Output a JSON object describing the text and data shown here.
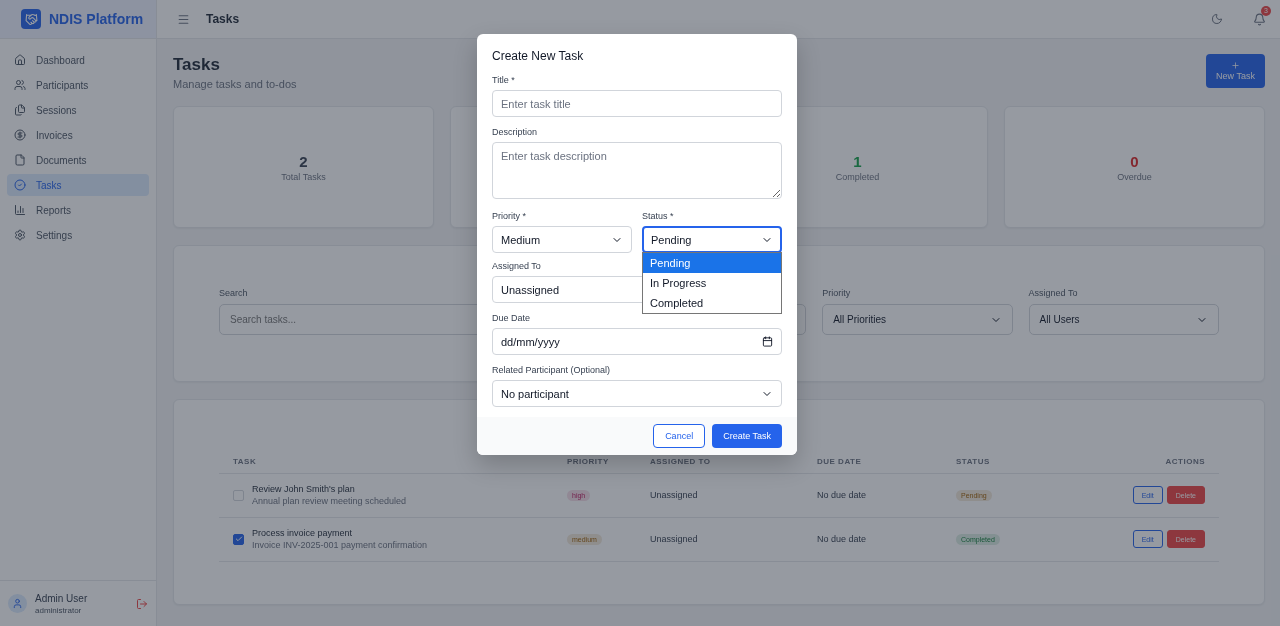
{
  "app": {
    "name": "NDIS Platform"
  },
  "sidebar": {
    "items": [
      {
        "label": "Dashboard",
        "selected": false
      },
      {
        "label": "Participants",
        "selected": false
      },
      {
        "label": "Sessions",
        "selected": false
      },
      {
        "label": "Invoices",
        "selected": false
      },
      {
        "label": "Documents",
        "selected": false
      },
      {
        "label": "Tasks",
        "selected": true
      },
      {
        "label": "Reports",
        "selected": false
      },
      {
        "label": "Settings",
        "selected": false
      }
    ],
    "user": {
      "name": "Admin User",
      "role": "administrator"
    }
  },
  "header": {
    "title": "Tasks",
    "notification_count": "3"
  },
  "page": {
    "title": "Tasks",
    "subtitle": "Manage tasks and to-dos",
    "new_button": "New Task"
  },
  "stats": [
    {
      "value": "2",
      "label": "Total Tasks",
      "kind": "neutral"
    },
    {
      "value": "1",
      "label": "Completed",
      "kind": "success"
    },
    {
      "value": "0",
      "label": "Overdue",
      "kind": "danger"
    }
  ],
  "filters": {
    "search": {
      "label": "Search",
      "placeholder": "Search tasks..."
    },
    "selects": [
      {
        "label": "Priority",
        "value": "All Priorities"
      },
      {
        "label": "Assigned To",
        "value": "All Users"
      }
    ]
  },
  "table": {
    "columns": [
      "TASK",
      "PRIORITY",
      "ASSIGNED TO",
      "DUE DATE",
      "STATUS",
      "ACTIONS"
    ],
    "rows": [
      {
        "title": "Review John Smith's plan",
        "description": "Annual plan review meeting scheduled",
        "checked": false,
        "priority": {
          "text": "high",
          "kind": "danger"
        },
        "assigned": "Unassigned",
        "due": "No due date",
        "status": {
          "text": "Pending",
          "kind": "warning"
        },
        "actions": [
          "Edit",
          "Delete"
        ]
      },
      {
        "title": "Process invoice payment",
        "description": "Invoice INV-2025-001 payment confirmation",
        "checked": true,
        "priority": {
          "text": "medium",
          "kind": "warning"
        },
        "assigned": "Unassigned",
        "due": "No due date",
        "status": {
          "text": "Completed",
          "kind": "success"
        },
        "actions": [
          "Edit",
          "Delete"
        ]
      }
    ]
  },
  "dialog": {
    "title": "Create New Task",
    "title_field": {
      "label": "Title *",
      "placeholder": "Enter task title"
    },
    "description_field": {
      "label": "Description",
      "placeholder": "Enter task description"
    },
    "priority_field": {
      "label": "Priority *",
      "value": "Medium"
    },
    "status_field": {
      "label": "Status *",
      "value": "Pending",
      "expanded": true,
      "options": [
        {
          "label": "Pending",
          "selected": true
        },
        {
          "label": "In Progress",
          "selected": false
        },
        {
          "label": "Completed",
          "selected": false
        }
      ]
    },
    "assigned_field": {
      "label": "Assigned To",
      "value": "Unassigned"
    },
    "due_field": {
      "label": "Due Date",
      "value": "dd/mm/yyyy"
    },
    "participant_field": {
      "label": "Related Participant (Optional)",
      "value": "No participant"
    },
    "buttons": {
      "cancel": "Cancel",
      "submit": "Create Task"
    }
  }
}
